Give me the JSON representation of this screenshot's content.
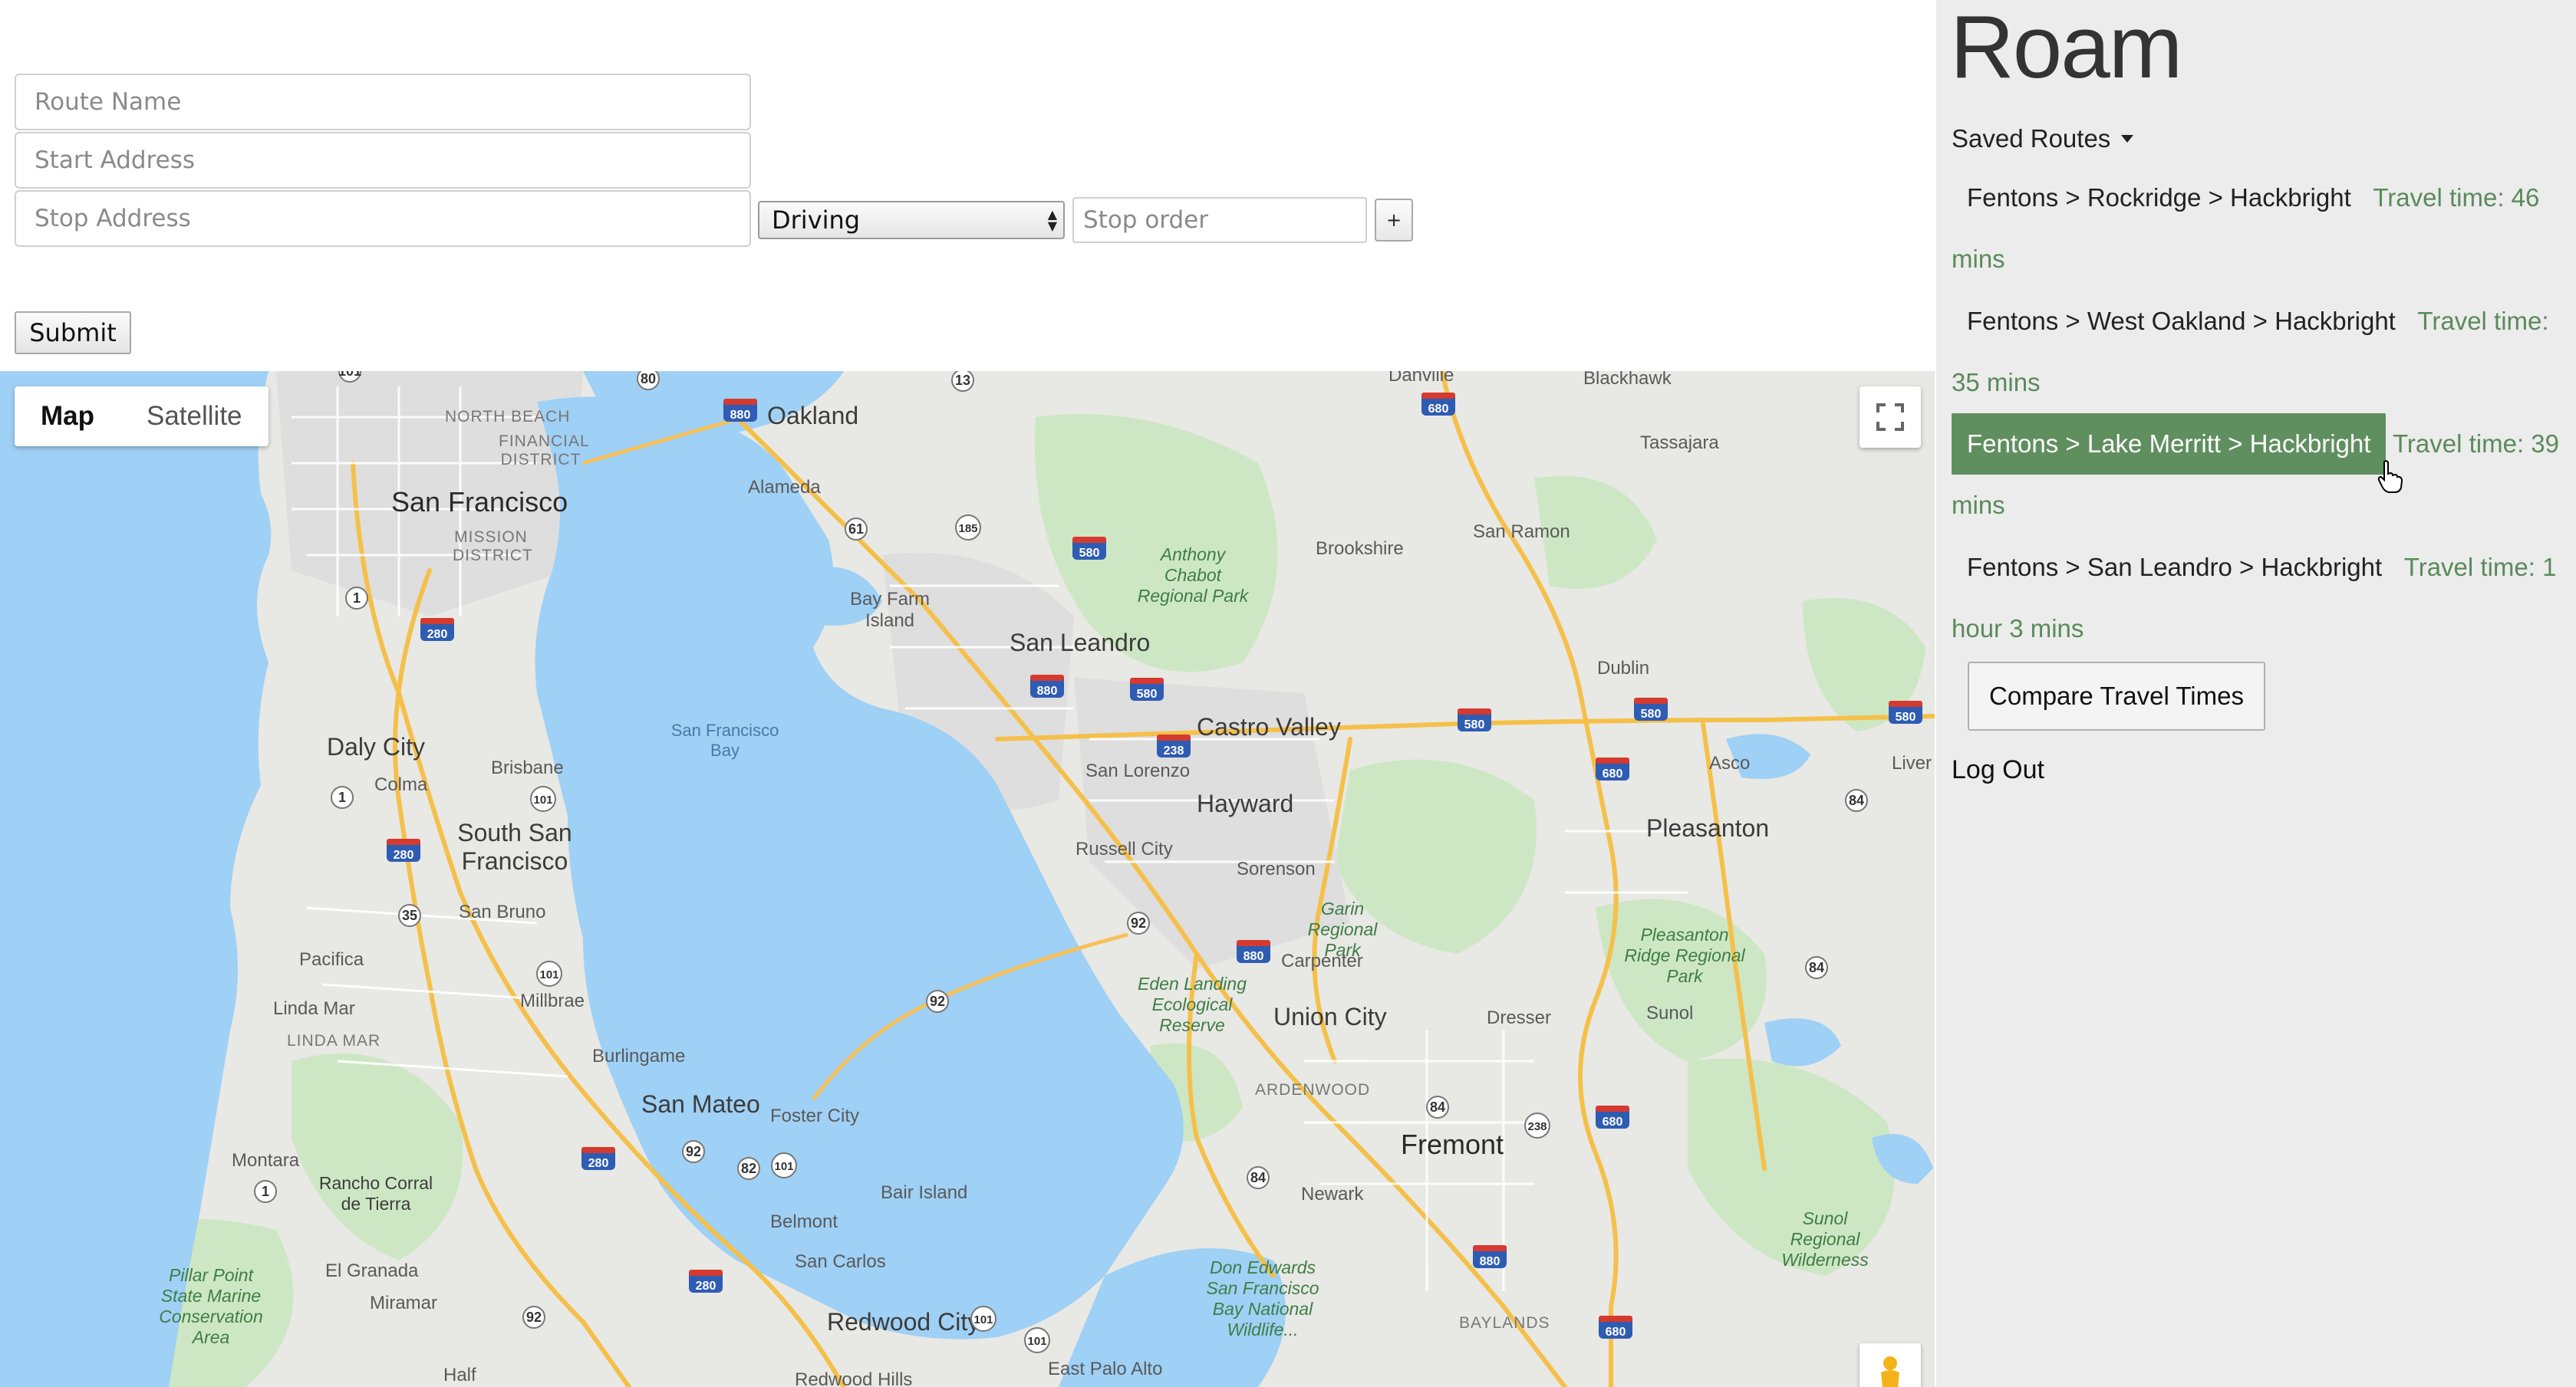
{
  "form": {
    "route_name_placeholder": "Route Name",
    "start_address_placeholder": "Start Address",
    "stop_address_placeholder": "Stop Address",
    "travel_mode": "Driving",
    "stop_order_placeholder": "Stop order",
    "add_stop_label": "+",
    "submit_label": "Submit"
  },
  "map": {
    "type_controls": [
      "Map",
      "Satellite"
    ],
    "active_type": "Map",
    "labels": {
      "oakland": "Oakland",
      "san_francisco": "San Francisco",
      "alameda": "Alameda",
      "north_beach": "NORTH BEACH",
      "financial_district": "FINANCIAL DISTRICT",
      "mission_district": "MISSION DISTRICT",
      "bay_farm_island": "Bay Farm Island",
      "san_leandro": "San Leandro",
      "anthony_chabot": "Anthony Chabot Regional Park",
      "brookshire": "Brookshire",
      "san_ramon": "San Ramon",
      "danville": "Danville",
      "blackhawk": "Blackhawk",
      "tassajara": "Tassajara",
      "dublin": "Dublin",
      "castro_valley": "Castro Valley",
      "san_lorenzo": "San Lorenzo",
      "hayward": "Hayward",
      "asco": "Asco",
      "livermore": "Liver",
      "pleasanton": "Pleasanton",
      "daly_city": "Daly City",
      "colma": "Colma",
      "brisbane": "Brisbane",
      "south_san_francisco": "South San Francisco",
      "san_bruno": "San Bruno",
      "sf_bay": "San Francisco Bay",
      "russell_city": "Russell City",
      "sorenson": "Sorenson",
      "garin": "Garin Regional Park",
      "carpenter": "Carpenter",
      "pleasanton_ridge": "Pleasanton Ridge Regional Park",
      "pacifica": "Pacifica",
      "linda_mar": "Linda Mar",
      "linda_mar_caps": "LINDA MAR",
      "millbrae": "Millbrae",
      "eden_landing": "Eden Landing Ecological Reserve",
      "union_city": "Union City",
      "dresser": "Dresser",
      "sunol": "Sunol",
      "burlingame": "Burlingame",
      "san_mateo": "San Mateo",
      "foster_city": "Foster City",
      "ardenwood": "ARDENWOOD",
      "fremont": "Fremont",
      "montara": "Montara",
      "rancho_corral": "Rancho Corral de Tierra",
      "bair_island": "Bair Island",
      "newark": "Newark",
      "sunol_wilderness": "Sunol Regional Wilderness",
      "belmont": "Belmont",
      "pillar_point": "Pillar Point State Marine Conservation Area",
      "el_granada": "El Granada",
      "miramar": "Miramar",
      "san_carlos": "San Carlos",
      "don_edwards": "Don Edwards San Francisco Bay National Wildlife...",
      "baylands": "BAYLANDS",
      "redwood_city": "Redwood City",
      "half": "Half",
      "redwood_hills": "Redwood Hills",
      "east_palo_alto": "East Palo Alto"
    },
    "shields": [
      "101",
      "80",
      "880",
      "13",
      "680",
      "61",
      "185",
      "580",
      "1",
      "280",
      "238",
      "84",
      "92",
      "35",
      "82"
    ]
  },
  "panel": {
    "app_title": "Roam",
    "saved_routes_label": "Saved Routes",
    "routes": [
      {
        "name": "Fentons > Rockridge > Hackbright",
        "travel_time": "Travel time: 46 mins",
        "active": false
      },
      {
        "name": "Fentons > West Oakland > Hackbright",
        "travel_time": "Travel time: 35 mins",
        "active": false
      },
      {
        "name": "Fentons > Lake Merritt > Hackbright",
        "travel_time": "Travel time: 39 mins",
        "active": true
      },
      {
        "name": "Fentons > San Leandro > Hackbright",
        "travel_time": "Travel time: 1 hour 3 mins",
        "active": false
      }
    ],
    "compare_label": "Compare Travel Times",
    "logout_label": "Log Out"
  },
  "colors": {
    "accent_green": "#5f8f5f",
    "travel_time_green": "#5b8a5b",
    "water": "#9fd0f5",
    "land": "#e8e8e4",
    "park": "#c9e6c0",
    "highway": "#f8c95a"
  }
}
